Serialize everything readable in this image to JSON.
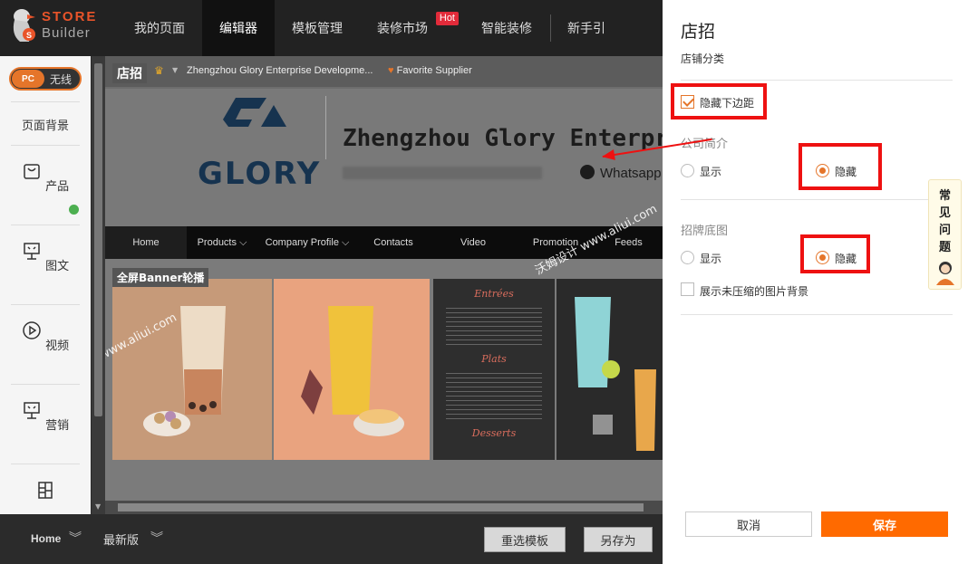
{
  "logo": {
    "line1": "STORE",
    "line2": "Builder"
  },
  "topnav": {
    "items": [
      "我的页面",
      "编辑器",
      "模板管理",
      "装修市场",
      "智能装修",
      "新手引"
    ],
    "hot_badge": "Hot",
    "active": "编辑器"
  },
  "sidebar": {
    "toggle_pc": "PC",
    "toggle_wireless": "无线",
    "items": [
      "页面背景",
      "产品",
      "图文",
      "视频",
      "营销"
    ]
  },
  "canvas": {
    "tag_dianzhao": "店招",
    "store_name": "Zhengzhou Glory Enterprise Developme...",
    "favorite": "Favorite Supplier",
    "company_title": "Zhengzhou Glory Enterprise D",
    "glory_logo": "GLORY",
    "whatsapp": "Whatsapp",
    "menu": [
      "Home",
      "Products",
      "Company Profile",
      "Contacts",
      "Video",
      "Promotion",
      "Feeds"
    ],
    "banner_tag": "全屏Banner轮播",
    "watermark": "沃姆设计 www.aliui.com",
    "menu_panel_title": "Entrées",
    "menu_panel_mid": "Plats",
    "menu_panel_bottom": "Desserts"
  },
  "bottombar": {
    "home": "Home",
    "version": "最新版",
    "reselect": "重选模板",
    "save_as": "另存为"
  },
  "panel": {
    "title": "店招",
    "subtitle": "店铺分类",
    "hide_bottom_margin": "隐藏下边距",
    "hide_bottom_margin_checked": true,
    "company_intro": {
      "label": "公司简介",
      "show": "显示",
      "hide": "隐藏",
      "selected": "隐藏"
    },
    "sign_bg": {
      "label": "招牌底图",
      "show": "显示",
      "hide": "隐藏",
      "selected": "隐藏"
    },
    "show_uncompressed": "展示未压缩的图片背景",
    "show_uncompressed_checked": false,
    "cancel": "取消",
    "save": "保存"
  },
  "faq": [
    "常",
    "见",
    "问",
    "题"
  ],
  "colors": {
    "accent": "#ff6a00",
    "highlight": "#e11111",
    "nav_bg": "#222222"
  }
}
